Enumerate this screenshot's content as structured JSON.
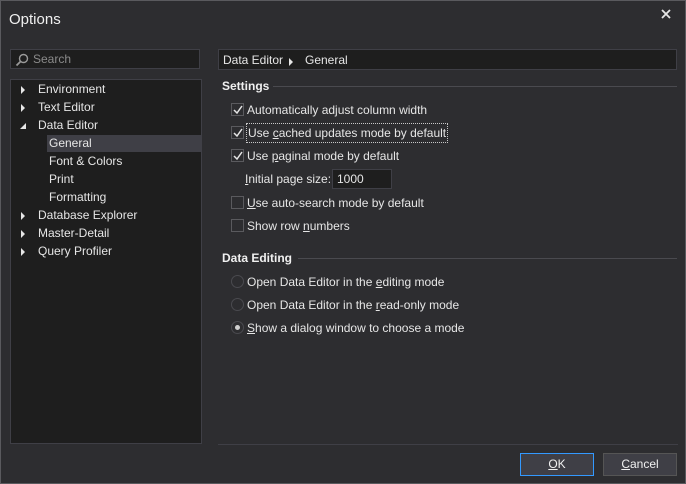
{
  "window": {
    "title": "Options"
  },
  "search": {
    "placeholder": "Search"
  },
  "tree": {
    "items": [
      {
        "label": "Environment",
        "expanded": false
      },
      {
        "label": "Text Editor",
        "expanded": false
      },
      {
        "label": "Data Editor",
        "expanded": true,
        "children": [
          "General",
          "Font & Colors",
          "Print",
          "Formatting"
        ],
        "selected_child": "General"
      },
      {
        "label": "Database Explorer",
        "expanded": false
      },
      {
        "label": "Master-Detail",
        "expanded": false
      },
      {
        "label": "Query Profiler",
        "expanded": false
      }
    ]
  },
  "breadcrumb": {
    "parent": "Data Editor",
    "current": "General"
  },
  "settings": {
    "heading": "Settings",
    "adjust_width": {
      "label": "Automatically adjust column width",
      "checked": true
    },
    "cached_updates": {
      "pre": "Use ",
      "mnemonic": "c",
      "post": "ached updates mode by default",
      "checked": true
    },
    "paginal": {
      "pre": "Use ",
      "mnemonic": "p",
      "post": "aginal mode by default",
      "checked": true
    },
    "page_size": {
      "pre": "",
      "mnemonic": "I",
      "post": "nitial page size:",
      "value": "1000"
    },
    "auto_search": {
      "pre": "",
      "mnemonic": "U",
      "post": "se auto-search mode by default",
      "checked": false
    },
    "row_numbers": {
      "pre": "Show row ",
      "mnemonic": "n",
      "post": "umbers",
      "checked": false
    }
  },
  "data_editing": {
    "heading": "Data Editing",
    "editing": {
      "pre": "Open Data Editor in the ",
      "mnemonic": "e",
      "post": "diting mode",
      "selected": false
    },
    "readonly": {
      "pre": "Open Data Editor in the ",
      "mnemonic": "r",
      "post": "ead-only mode",
      "selected": false
    },
    "dialog": {
      "pre": "",
      "mnemonic": "S",
      "post": "how a dialog window to choose a mode",
      "selected": true
    }
  },
  "buttons": {
    "ok": {
      "mnemonic": "O",
      "post": "K"
    },
    "cancel": {
      "mnemonic": "C",
      "post": "ancel"
    }
  },
  "icons": {
    "search": "search-icon",
    "close": "close-icon",
    "expand": "expand-arrow-icon",
    "collapse": "collapse-arrow-icon",
    "check": "check-icon"
  },
  "colors": {
    "background": "#2d2d30",
    "panel": "#1e1e1e",
    "selection": "#3f3f46",
    "accent": "#3399ff"
  }
}
